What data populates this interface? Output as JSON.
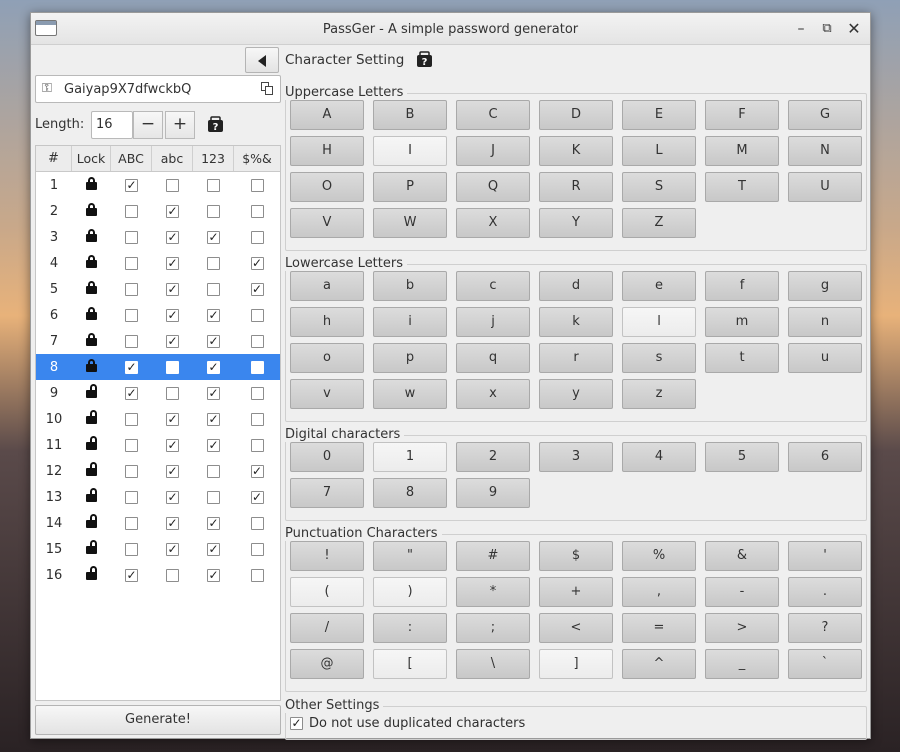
{
  "window": {
    "title": "PassGer - A simple password generator"
  },
  "password": {
    "value": "Gaiyap9X7dfwckbQ"
  },
  "length": {
    "label": "Length:",
    "value": "16",
    "minus": "−",
    "plus": "+"
  },
  "table": {
    "headers": [
      "#",
      "Lock",
      "ABC",
      "abc",
      "123",
      "$%&"
    ],
    "rows": [
      {
        "n": "1",
        "locked": true,
        "u": true,
        "l": false,
        "d": false,
        "p": false
      },
      {
        "n": "2",
        "locked": true,
        "u": false,
        "l": true,
        "d": false,
        "p": false
      },
      {
        "n": "3",
        "locked": true,
        "u": false,
        "l": true,
        "d": true,
        "p": false
      },
      {
        "n": "4",
        "locked": true,
        "u": false,
        "l": true,
        "d": false,
        "p": true
      },
      {
        "n": "5",
        "locked": true,
        "u": false,
        "l": true,
        "d": false,
        "p": true
      },
      {
        "n": "6",
        "locked": true,
        "u": false,
        "l": true,
        "d": true,
        "p": false
      },
      {
        "n": "7",
        "locked": true,
        "u": false,
        "l": true,
        "d": true,
        "p": false
      },
      {
        "n": "8",
        "locked": true,
        "u": true,
        "l": false,
        "d": true,
        "p": false,
        "selected": true
      },
      {
        "n": "9",
        "locked": false,
        "u": true,
        "l": false,
        "d": true,
        "p": false
      },
      {
        "n": "10",
        "locked": false,
        "u": false,
        "l": true,
        "d": true,
        "p": false
      },
      {
        "n": "11",
        "locked": false,
        "u": false,
        "l": true,
        "d": true,
        "p": false
      },
      {
        "n": "12",
        "locked": false,
        "u": false,
        "l": true,
        "d": false,
        "p": true
      },
      {
        "n": "13",
        "locked": false,
        "u": false,
        "l": true,
        "d": false,
        "p": true
      },
      {
        "n": "14",
        "locked": false,
        "u": false,
        "l": true,
        "d": true,
        "p": false
      },
      {
        "n": "15",
        "locked": false,
        "u": false,
        "l": true,
        "d": true,
        "p": false
      },
      {
        "n": "16",
        "locked": false,
        "u": true,
        "l": false,
        "d": true,
        "p": false
      }
    ]
  },
  "generate_label": "Generate!",
  "settings": {
    "title": "Character Setting",
    "groups": [
      {
        "label": "Uppercase Letters",
        "keys": [
          {
            "k": "A",
            "on": true
          },
          {
            "k": "B",
            "on": true
          },
          {
            "k": "C",
            "on": true
          },
          {
            "k": "D",
            "on": true
          },
          {
            "k": "E",
            "on": true
          },
          {
            "k": "F",
            "on": true
          },
          {
            "k": "G",
            "on": true
          },
          {
            "k": "H",
            "on": true
          },
          {
            "k": "I",
            "on": false
          },
          {
            "k": "J",
            "on": true
          },
          {
            "k": "K",
            "on": true
          },
          {
            "k": "L",
            "on": true
          },
          {
            "k": "M",
            "on": true
          },
          {
            "k": "N",
            "on": true
          },
          {
            "k": "O",
            "on": true
          },
          {
            "k": "P",
            "on": true
          },
          {
            "k": "Q",
            "on": true
          },
          {
            "k": "R",
            "on": true
          },
          {
            "k": "S",
            "on": true
          },
          {
            "k": "T",
            "on": true
          },
          {
            "k": "U",
            "on": true
          },
          {
            "k": "V",
            "on": true
          },
          {
            "k": "W",
            "on": true
          },
          {
            "k": "X",
            "on": true
          },
          {
            "k": "Y",
            "on": true
          },
          {
            "k": "Z",
            "on": true
          }
        ]
      },
      {
        "label": "Lowercase Letters",
        "keys": [
          {
            "k": "a",
            "on": true
          },
          {
            "k": "b",
            "on": true
          },
          {
            "k": "c",
            "on": true
          },
          {
            "k": "d",
            "on": true
          },
          {
            "k": "e",
            "on": true
          },
          {
            "k": "f",
            "on": true
          },
          {
            "k": "g",
            "on": true
          },
          {
            "k": "h",
            "on": true
          },
          {
            "k": "i",
            "on": true
          },
          {
            "k": "j",
            "on": true
          },
          {
            "k": "k",
            "on": true
          },
          {
            "k": "l",
            "on": false
          },
          {
            "k": "m",
            "on": true
          },
          {
            "k": "n",
            "on": true
          },
          {
            "k": "o",
            "on": true
          },
          {
            "k": "p",
            "on": true
          },
          {
            "k": "q",
            "on": true
          },
          {
            "k": "r",
            "on": true
          },
          {
            "k": "s",
            "on": true
          },
          {
            "k": "t",
            "on": true
          },
          {
            "k": "u",
            "on": true
          },
          {
            "k": "v",
            "on": true
          },
          {
            "k": "w",
            "on": true
          },
          {
            "k": "x",
            "on": true
          },
          {
            "k": "y",
            "on": true
          },
          {
            "k": "z",
            "on": true
          }
        ]
      },
      {
        "label": "Digital characters",
        "keys": [
          {
            "k": "0",
            "on": true
          },
          {
            "k": "1",
            "on": false
          },
          {
            "k": "2",
            "on": true
          },
          {
            "k": "3",
            "on": true
          },
          {
            "k": "4",
            "on": true
          },
          {
            "k": "5",
            "on": true
          },
          {
            "k": "6",
            "on": true
          },
          {
            "k": "7",
            "on": true
          },
          {
            "k": "8",
            "on": true
          },
          {
            "k": "9",
            "on": true
          }
        ]
      },
      {
        "label": "Punctuation Characters",
        "keys": [
          {
            "k": "!",
            "on": true
          },
          {
            "k": "\"",
            "on": true
          },
          {
            "k": "#",
            "on": true
          },
          {
            "k": "$",
            "on": true
          },
          {
            "k": "%",
            "on": true
          },
          {
            "k": "&",
            "on": true
          },
          {
            "k": "'",
            "on": true
          },
          {
            "k": "(",
            "on": false
          },
          {
            "k": ")",
            "on": false
          },
          {
            "k": "*",
            "on": true
          },
          {
            "k": "+",
            "on": true
          },
          {
            "k": ",",
            "on": true
          },
          {
            "k": "-",
            "on": true
          },
          {
            "k": ".",
            "on": true
          },
          {
            "k": "/",
            "on": true
          },
          {
            "k": ":",
            "on": true
          },
          {
            "k": ";",
            "on": true
          },
          {
            "k": "<",
            "on": true
          },
          {
            "k": "=",
            "on": true
          },
          {
            "k": ">",
            "on": true
          },
          {
            "k": "?",
            "on": true
          },
          {
            "k": "@",
            "on": true
          },
          {
            "k": "[",
            "on": false
          },
          {
            "k": "\\",
            "on": true
          },
          {
            "k": "]",
            "on": false
          },
          {
            "k": "^",
            "on": true
          },
          {
            "k": "_",
            "on": true
          },
          {
            "k": "`",
            "on": true
          }
        ]
      }
    ],
    "other": {
      "label": "Other Settings",
      "no_dup_label": "Do not use duplicated characters",
      "no_dup_checked": true
    }
  },
  "colors": {
    "selection": "#3a86ee",
    "window_bg": "#efefef"
  }
}
